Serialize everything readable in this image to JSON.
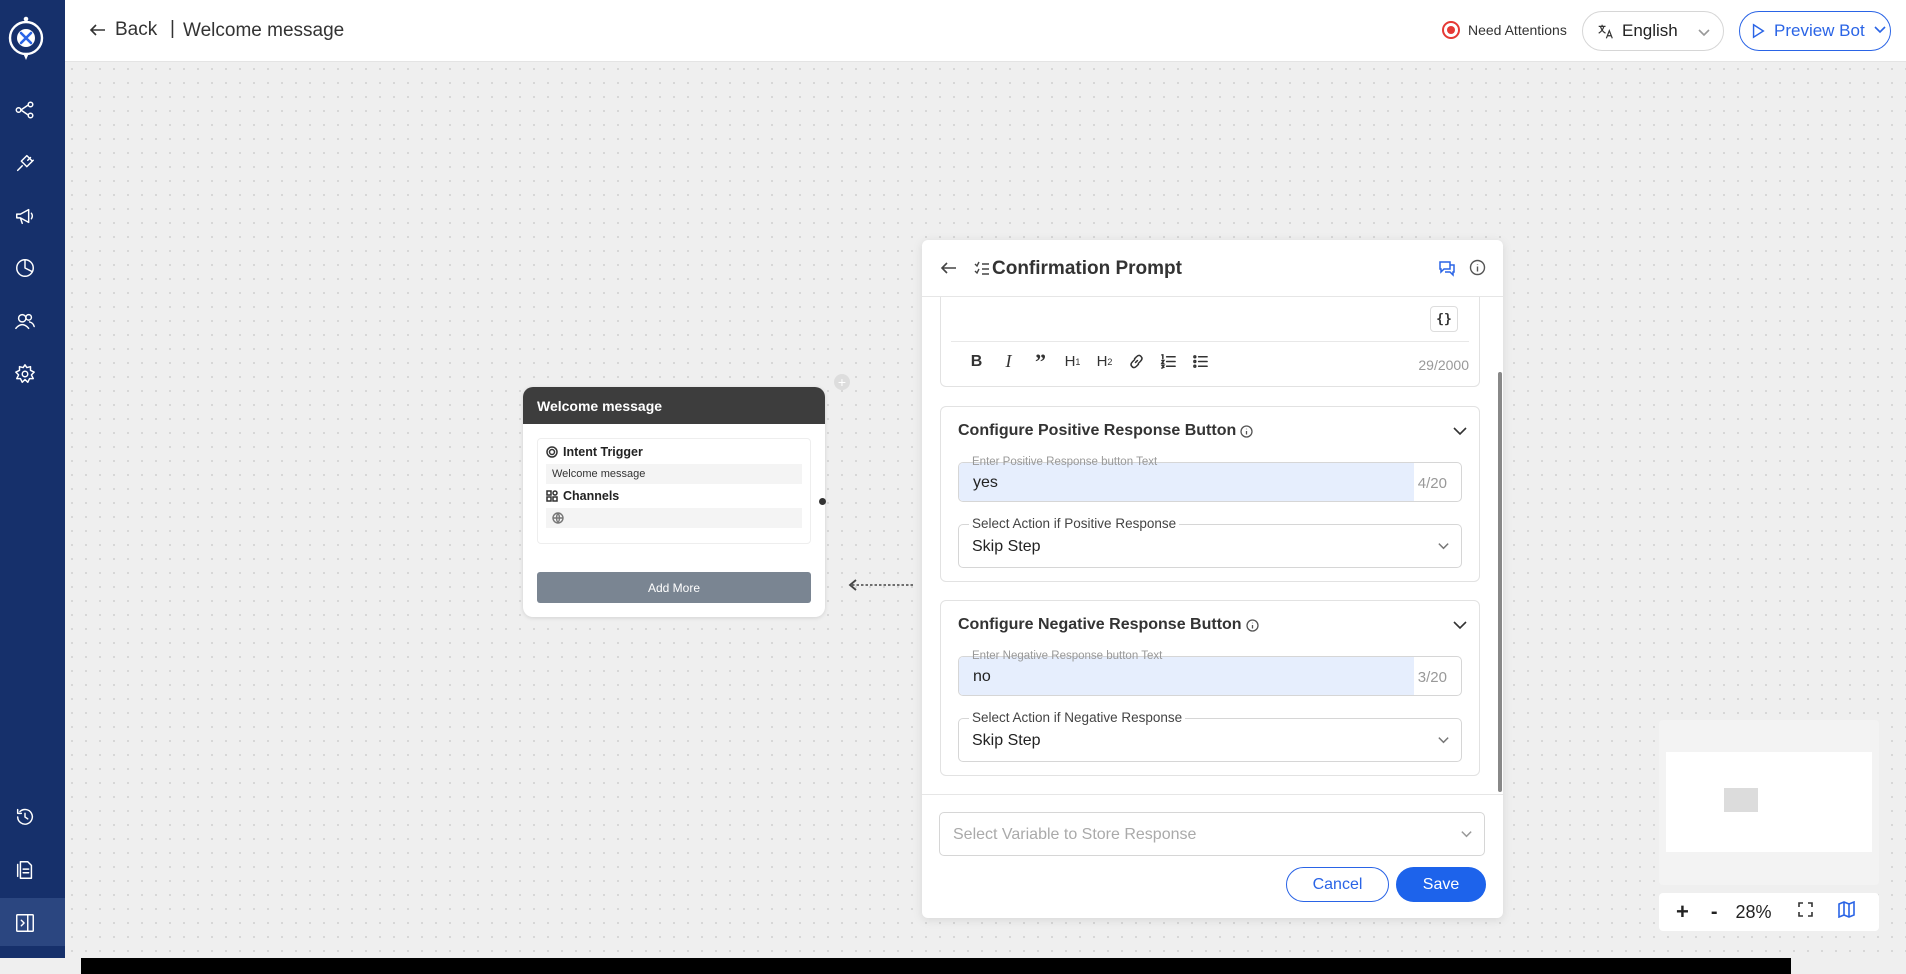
{
  "header": {
    "back_label": "Back",
    "separator": "|",
    "page_title": "Welcome message",
    "attention_label": "Need Attentions",
    "language": "English",
    "preview_label": "Preview Bot"
  },
  "sidebar": {
    "items": [
      "flow-icon",
      "integrations-icon",
      "broadcast-icon",
      "analytics-icon",
      "users-icon",
      "settings-icon",
      "history-icon",
      "docs-icon",
      "collapse-icon"
    ]
  },
  "node": {
    "title": "Welcome message",
    "trigger_label": "Intent Trigger",
    "trigger_value": "Welcome message",
    "channels_label": "Channels",
    "add_more_label": "Add More"
  },
  "panel": {
    "title": "Confirmation Prompt",
    "variable_button": "{}",
    "char_counter": "29/2000",
    "positive": {
      "title": "Configure Positive Response Button",
      "input_label": "Enter Positive Response button Text",
      "input_value": "yes",
      "input_counter": "4/20",
      "select_label": "Select Action if Positive Response",
      "select_value": "Skip Step"
    },
    "negative": {
      "title": "Configure Negative Response Button",
      "input_label": "Enter Negative Response button Text",
      "input_value": "no",
      "input_counter": "3/20",
      "select_label": "Select Action if Negative Response",
      "select_value": "Skip Step"
    },
    "variable_placeholder": "Select Variable to Store Response",
    "cancel_label": "Cancel",
    "save_label": "Save"
  },
  "zoom": {
    "plus": "+",
    "minus": "-",
    "level": "28%"
  },
  "colors": {
    "sidebar": "#16306b",
    "accent": "#1d63eb",
    "attention": "#e53935"
  }
}
